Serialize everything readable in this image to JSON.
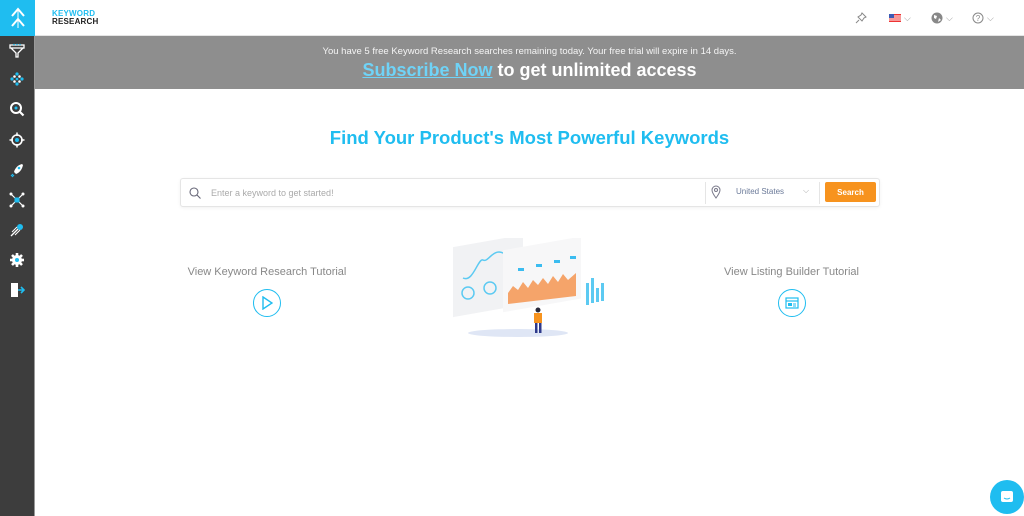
{
  "brand": {
    "line1": "KEYWORD",
    "line2": "RESEARCH"
  },
  "sidebar": {
    "items": [
      {
        "icon": "filter-funnel-icon"
      },
      {
        "icon": "grid-dots-icon"
      },
      {
        "icon": "magnifier-icon"
      },
      {
        "icon": "target-crosshair-icon"
      },
      {
        "icon": "rocket-icon"
      },
      {
        "icon": "network-nodes-icon"
      },
      {
        "icon": "shooting-star-icon"
      },
      {
        "icon": "gear-icon"
      },
      {
        "icon": "logout-door-icon"
      }
    ]
  },
  "topbar": {
    "icons": [
      "pin-icon",
      "us-flag-icon",
      "globe-icon",
      "help-icon"
    ]
  },
  "banner": {
    "notice": "You have 5 free Keyword Research searches remaining today. Your free trial will expire in 14 days.",
    "link_label": "Subscribe Now",
    "tail": " to get unlimited access"
  },
  "main": {
    "headline": "Find Your Product's Most Powerful Keywords",
    "search": {
      "placeholder": "Enter a keyword to get started!",
      "value": "",
      "country": "United States",
      "button_label": "Search"
    },
    "tutorials": [
      {
        "label": "View Keyword Research Tutorial",
        "icon": "play-icon"
      },
      {
        "label": "View Listing Builder Tutorial",
        "icon": "browser-window-icon"
      }
    ]
  },
  "colors": {
    "accent": "#1fbdf0",
    "button": "#f7931e",
    "sidebar": "#3d3d3d",
    "banner": "#8e8e8e"
  }
}
